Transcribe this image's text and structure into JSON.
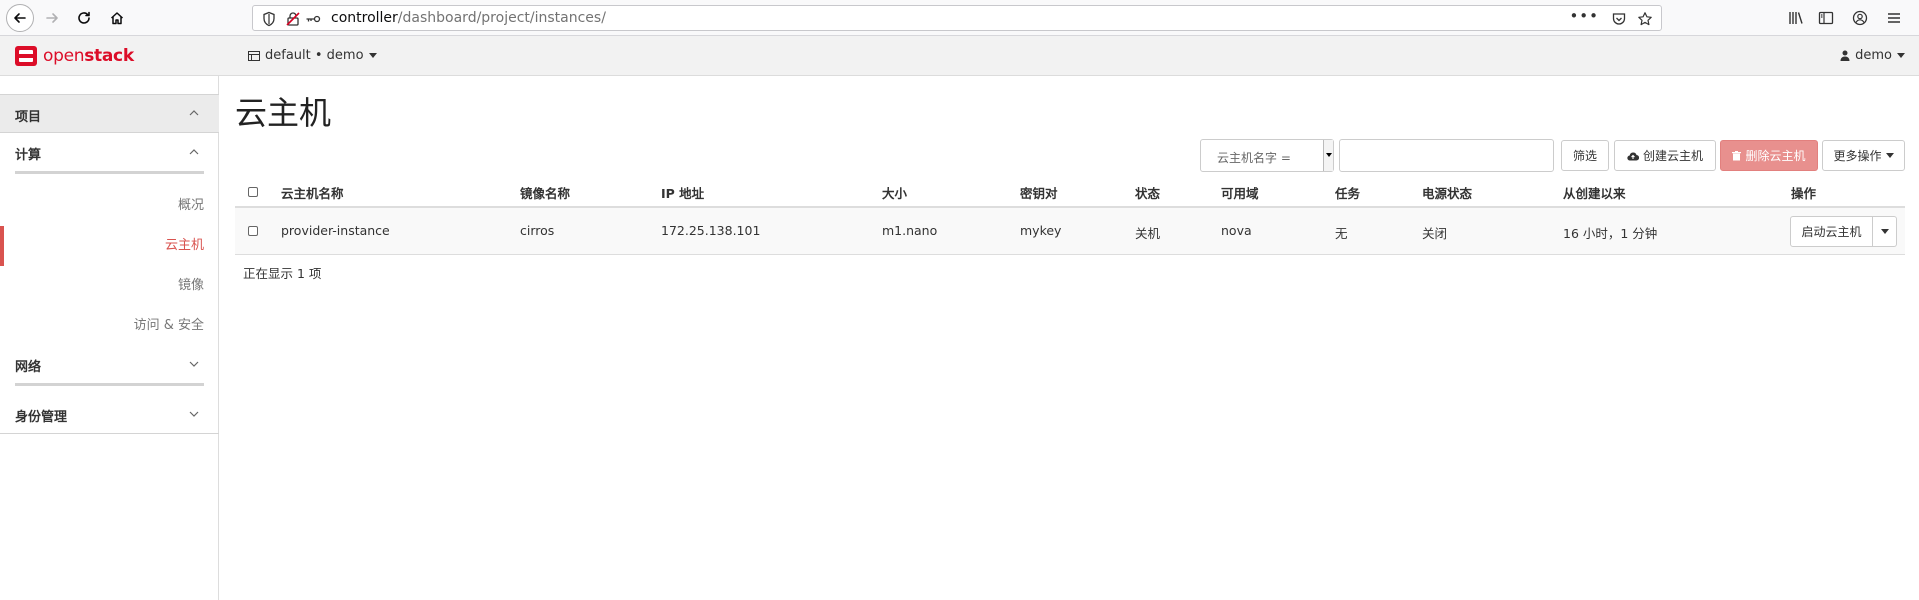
{
  "browser": {
    "url_host": "controller",
    "url_path": "/dashboard/project/instances/",
    "url_menu": "•••"
  },
  "header": {
    "brand_open": "open",
    "brand_stack": "stack",
    "project": "default • demo",
    "user": "demo"
  },
  "sidebar": {
    "section_project": "项目",
    "compute": "计算",
    "items": [
      "概况",
      "云主机",
      "镜像",
      "访问 & 安全"
    ],
    "network": "网络",
    "identity": "身份管理"
  },
  "main": {
    "title": "云主机",
    "filter_field": "云主机名字 =",
    "filter_value": "",
    "filter_button": "筛选",
    "create_button": "创建云主机",
    "delete_button": "删除云主机",
    "more_button": "更多操作"
  },
  "table": {
    "columns": [
      "云主机名称",
      "镜像名称",
      "IP 地址",
      "大小",
      "密钥对",
      "状态",
      "可用域",
      "任务",
      "电源状态",
      "从创建以来",
      "操作"
    ],
    "rows": [
      {
        "name": "provider-instance",
        "image": "cirros",
        "ip": "172.25.138.101",
        "size": "m1.nano",
        "keypair": "mykey",
        "status": "关机",
        "az": "nova",
        "task": "无",
        "power": "关闭",
        "age": "16 小时，1 分钟",
        "action": "启动云主机"
      }
    ],
    "count_text": "正在显示 1 项"
  },
  "colors": {
    "brand_red": "#dc0d28",
    "link_blue": "#337ab7",
    "danger": "#e8908e",
    "active_red": "#d9534f"
  }
}
